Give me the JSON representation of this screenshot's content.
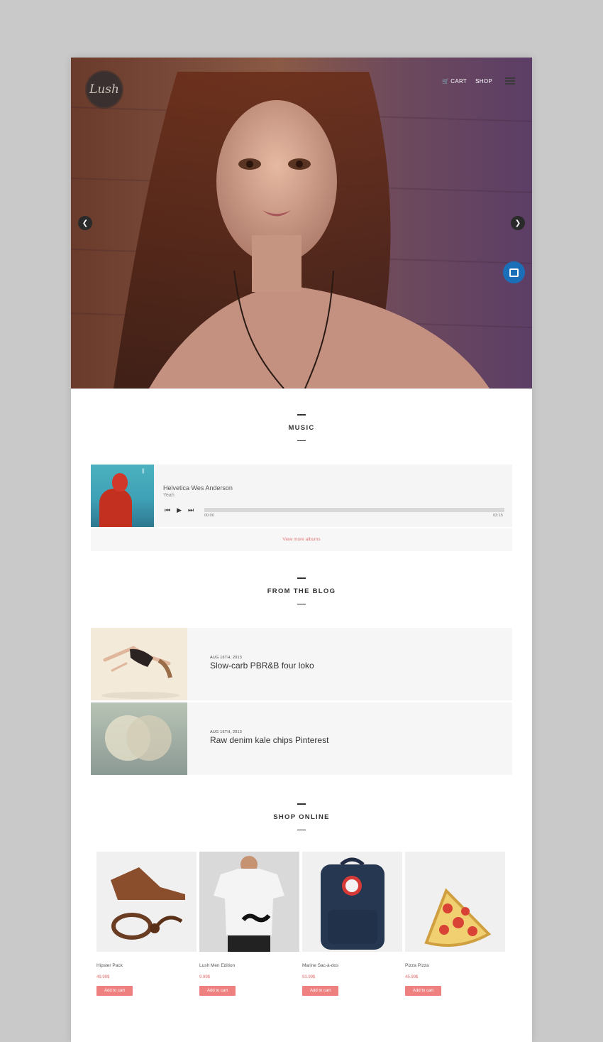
{
  "header": {
    "logo_text": "Lush",
    "nav": {
      "cart_label": "CART",
      "shop_label": "SHOP"
    }
  },
  "music": {
    "section_title": "MUSIC",
    "album_tag": "||",
    "track_title": "Helvetica Wes Anderson",
    "track_artist": "Yeah",
    "time_start": "00:00",
    "time_end": "03:15",
    "progress": 0,
    "more_link": "View more albums"
  },
  "blog": {
    "section_title": "FROM THE BLOG",
    "posts": [
      {
        "date": "AUG 16TH, 2013",
        "title": "Slow-carb PBR&B four loko"
      },
      {
        "date": "AUG 16TH, 2013",
        "title": "Raw denim kale chips Pinterest"
      }
    ]
  },
  "shop": {
    "section_title": "SHOP ONLINE",
    "products": [
      {
        "name": "Hipster Pack",
        "price": "49.99$",
        "button": "Add to cart"
      },
      {
        "name": "Lush Men Edition",
        "price": "9.99$",
        "button": "Add to cart"
      },
      {
        "name": "Marine Sac-à-dos",
        "price": "93.99$",
        "button": "Add to cart"
      },
      {
        "name": "Pizza Pizza",
        "price": "45.99$",
        "button": "Add to cart"
      }
    ]
  },
  "colors": {
    "accent": "#ef8080",
    "chat": "#1a6fb8"
  }
}
